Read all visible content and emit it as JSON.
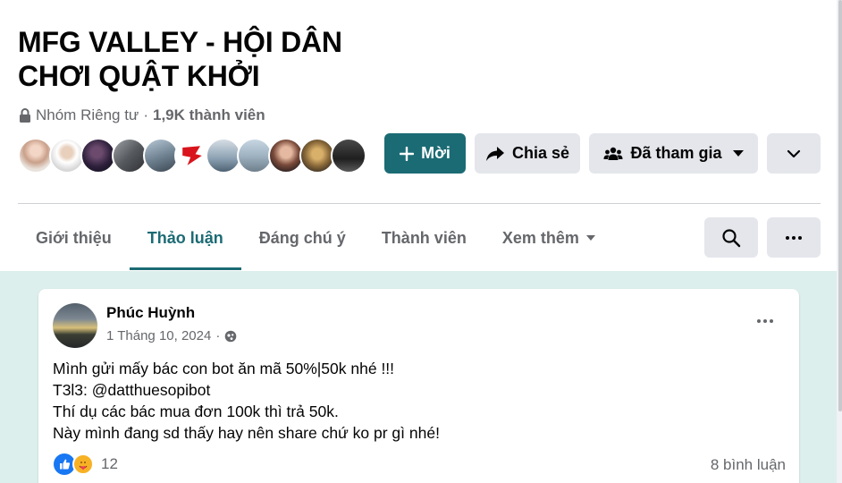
{
  "group": {
    "title_line1": "MFG VALLEY - HỘI DÂN",
    "title_line2": "CHƠI QUẬT KHỞI",
    "privacy": "Nhóm Riêng tư",
    "separator": "·",
    "members": "1,9K thành viên"
  },
  "actions": {
    "invite_label": "Mời",
    "share_label": "Chia sẻ",
    "joined_label": "Đã tham gia"
  },
  "tabs": [
    {
      "label": "Giới thiệu",
      "active": false
    },
    {
      "label": "Thảo luận",
      "active": true
    },
    {
      "label": "Đáng chú ý",
      "active": false
    },
    {
      "label": "Thành viên",
      "active": false
    },
    {
      "label": "Xem thêm",
      "active": false
    }
  ],
  "post": {
    "author": "Phúc Huỳnh",
    "time": "1 Tháng 10, 2024",
    "separator": "·",
    "lines": [
      "Mình gửi mấy bác con bot ăn mã 50%|50k nhé !!!",
      "T3l3: @datthuesopibot",
      "Thí dụ các bác mua đơn 100k thì trả 50k.",
      "Này mình đang sd thấy hay nên share chứ ko pr gì nhé!"
    ],
    "reaction_count": "12",
    "comment_count": "8 bình luận"
  },
  "icons": {
    "privacy": "lock-icon",
    "invite": "plus-icon",
    "share": "share-arrow-icon",
    "joined": "group-people-icon",
    "search": "search-icon",
    "more": "ellipsis-icon",
    "audience": "globe-icon",
    "reaction_1": "like-icon",
    "reaction_2": "care-icon"
  },
  "colors": {
    "accent": "#1b6b74",
    "button_gray": "#e4e6eb",
    "feed_bg": "#dcefec",
    "secondary_text": "#65676b",
    "like_blue": "#1877f2",
    "care_yellow": "#f7b125"
  }
}
